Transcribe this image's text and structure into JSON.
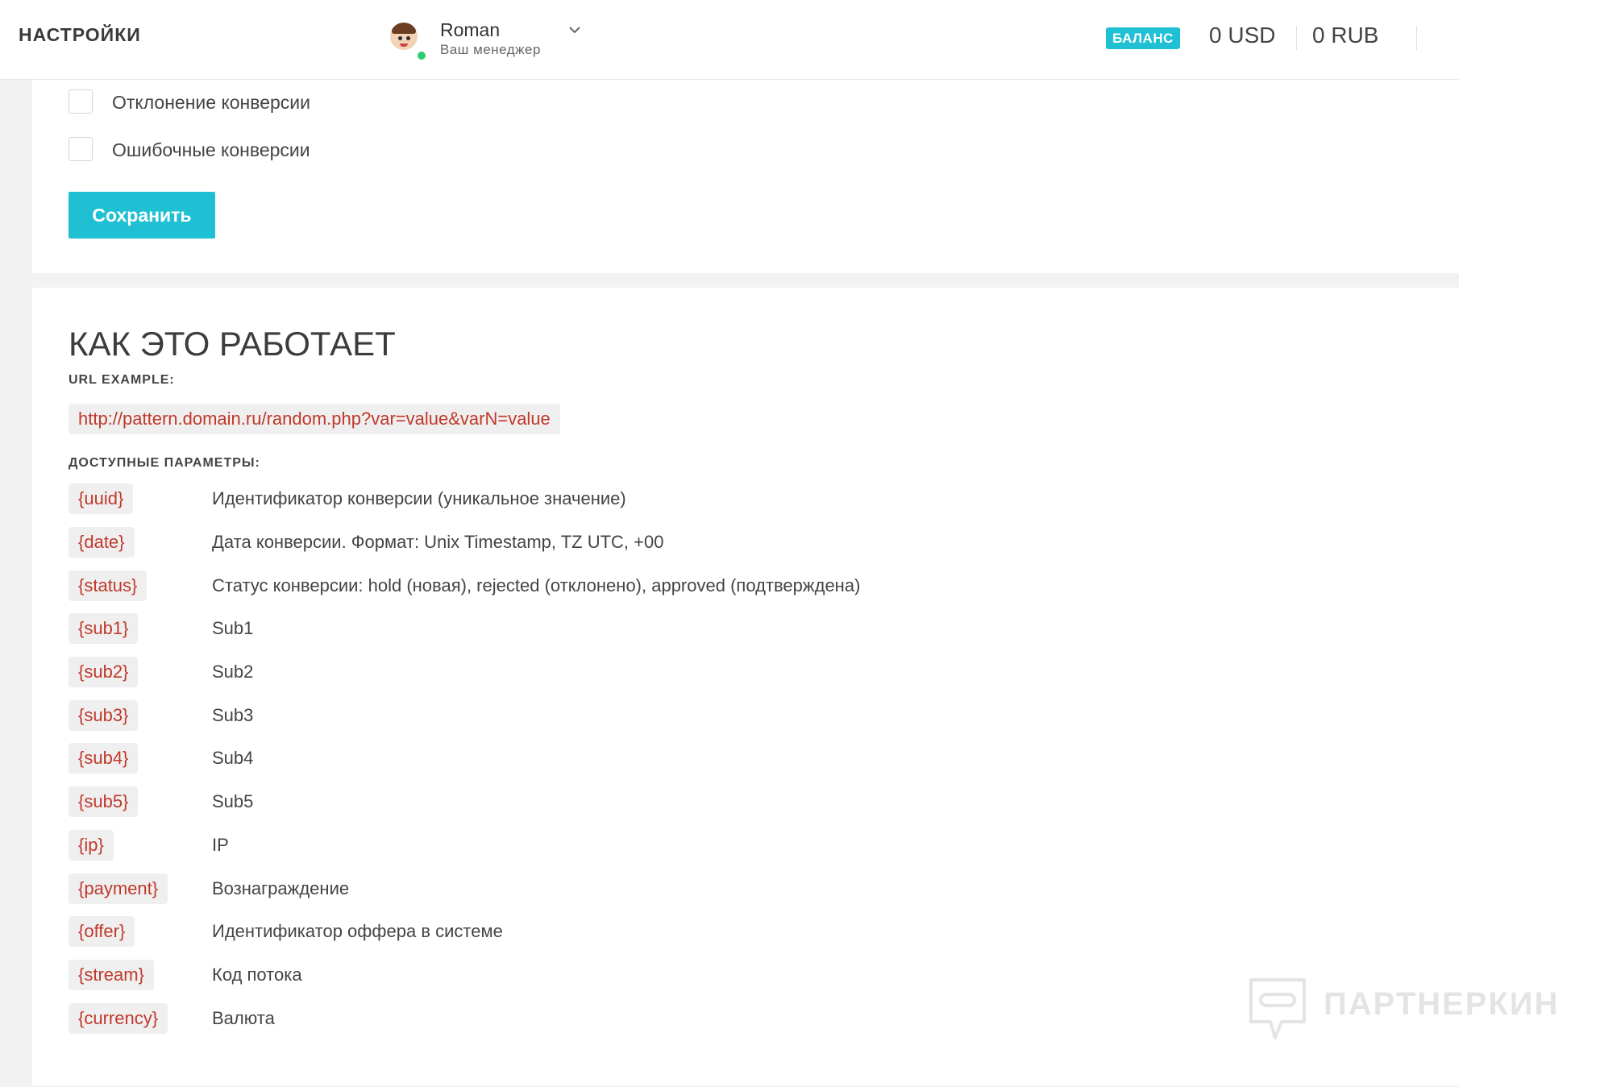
{
  "header": {
    "title": "НАСТРОЙКИ",
    "manager": {
      "name": "Roman",
      "role": "Ваш менеджер",
      "status": "online"
    },
    "balance": {
      "badge": "БАЛАНС",
      "usd": "0 USD",
      "rub": "0 RUB"
    }
  },
  "notifications": {
    "items": [
      {
        "label": "Отклонение конверсии",
        "checked": false
      },
      {
        "label": "Ошибочные конверсии",
        "checked": false
      }
    ],
    "save_label": "Сохранить"
  },
  "how_it_works": {
    "title": "КАК ЭТО РАБОТАЕТ",
    "url_label": "URL EXAMPLE:",
    "url_example": "http://pattern.domain.ru/random.php?var=value&varN=value",
    "params_label": "ДОСТУПНЫЕ ПАРАМЕТРЫ:",
    "params": [
      {
        "code": "{uuid}",
        "desc": "Идентификатор конверсии (уникальное значение)"
      },
      {
        "code": "{date}",
        "desc": "Дата конверсии. Формат: Unix Timestamp, TZ UTC, +00"
      },
      {
        "code": "{status}",
        "desc": "Статус конверсии: hold (новая), rejected (отклонено), approved (подтверждена)"
      },
      {
        "code": "{sub1}",
        "desc": "Sub1"
      },
      {
        "code": "{sub2}",
        "desc": "Sub2"
      },
      {
        "code": "{sub3}",
        "desc": "Sub3"
      },
      {
        "code": "{sub4}",
        "desc": "Sub4"
      },
      {
        "code": "{sub5}",
        "desc": "Sub5"
      },
      {
        "code": "{ip}",
        "desc": "IP"
      },
      {
        "code": "{payment}",
        "desc": "Вознаграждение"
      },
      {
        "code": "{offer}",
        "desc": "Идентификатор оффера в системе"
      },
      {
        "code": "{stream}",
        "desc": "Код потока"
      },
      {
        "code": "{currency}",
        "desc": "Валюта"
      }
    ]
  },
  "watermark": {
    "text": "ПАРТНЕРКИН"
  },
  "colors": {
    "accent": "#1fc0d4",
    "code": "#c0392b",
    "online": "#2ecc71"
  },
  "icons": {
    "avatar": "avatar-icon",
    "chevron": "chevron-down-icon",
    "watermark": "chat-logo-icon"
  }
}
